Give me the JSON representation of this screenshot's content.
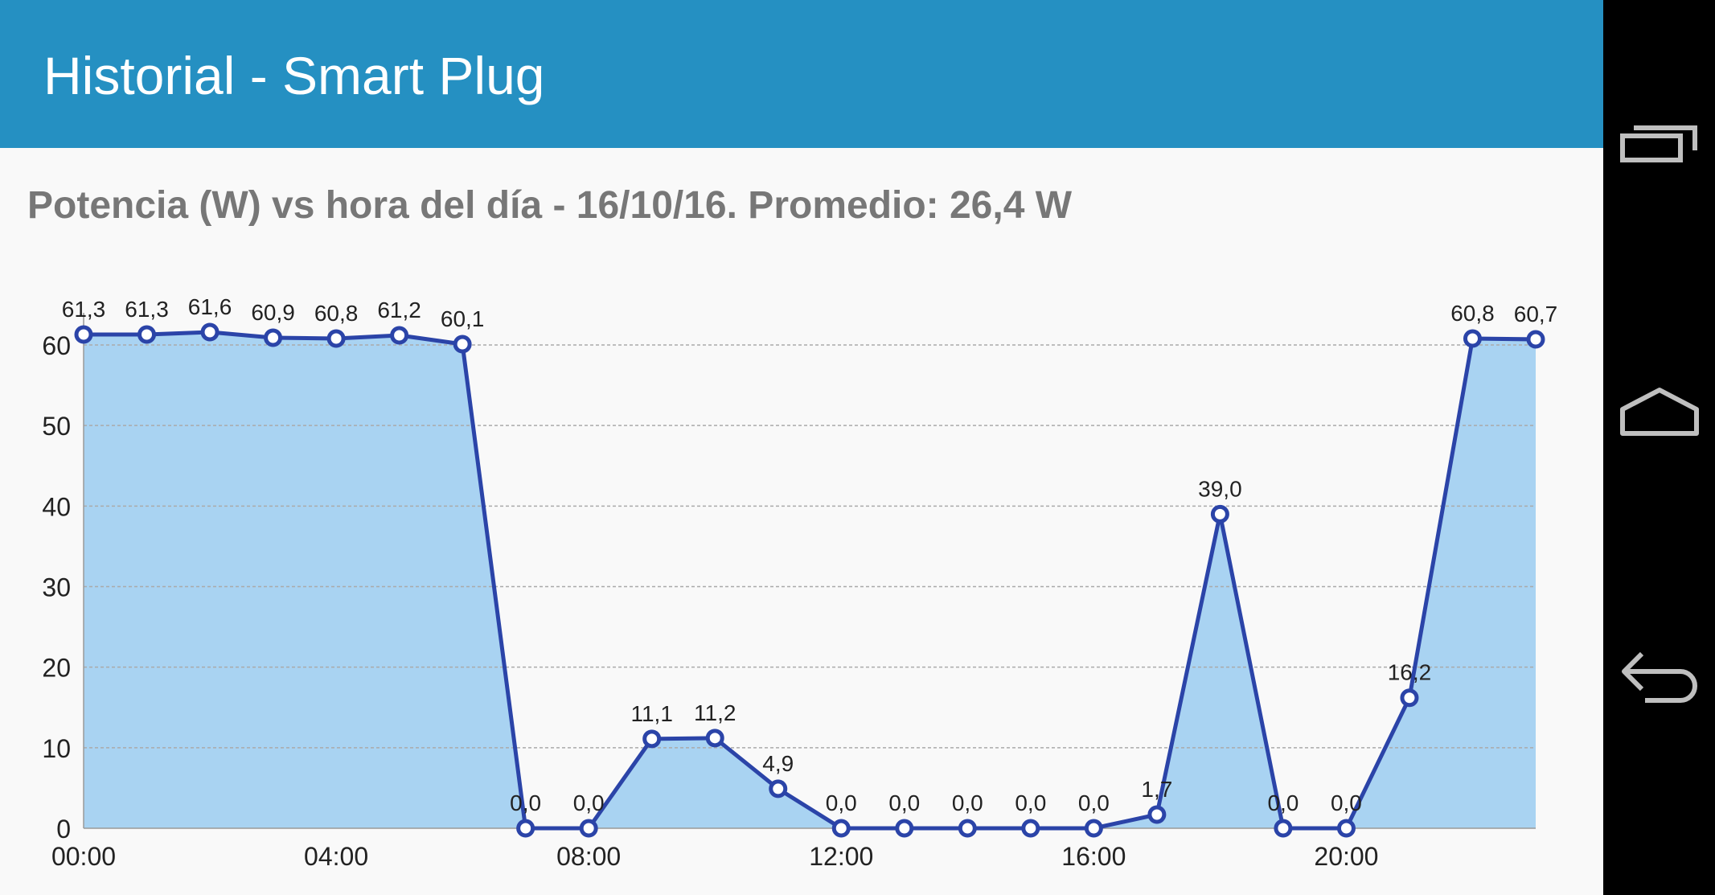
{
  "appbar": {
    "title": "Historial - Smart Plug"
  },
  "chart_title": "Potencia (W) vs hora del día - 16/10/16. Promedio: 26,4 W",
  "chart_data": {
    "type": "area",
    "title": "Potencia (W) vs hora del día - 16/10/16. Promedio: 26,4 W",
    "xlabel": "",
    "ylabel": "",
    "x": [
      0,
      1,
      2,
      3,
      4,
      5,
      6,
      7,
      8,
      9,
      10,
      11,
      12,
      13,
      14,
      15,
      16,
      17,
      18,
      19,
      20,
      21,
      22,
      23
    ],
    "x_tick_values": [
      0,
      4,
      8,
      12,
      16,
      20
    ],
    "x_tick_labels": [
      "00:00",
      "04:00",
      "08:00",
      "12:00",
      "16:00",
      "20:00"
    ],
    "xlim": [
      0,
      23
    ],
    "ylim": [
      0,
      60
    ],
    "y_ticks": [
      0,
      10,
      20,
      30,
      40,
      50,
      60
    ],
    "grid": true,
    "series": [
      {
        "values": [
          61.3,
          61.3,
          61.6,
          60.9,
          60.8,
          61.2,
          60.1,
          0.0,
          0.0,
          11.1,
          11.2,
          4.9,
          0.0,
          0.0,
          0.0,
          0.0,
          0.0,
          1.7,
          39.0,
          0.0,
          0.0,
          16.2,
          60.8,
          60.7
        ],
        "labels": [
          "61,3",
          "61,3",
          "61,6",
          "60,9",
          "60,8",
          "61,2",
          "60,1",
          "0,0",
          "0,0",
          "11,1",
          "11,2",
          "4,9",
          "0,0",
          "0,0",
          "0,0",
          "0,0",
          "0,0",
          "1,7",
          "39,0",
          "0,0",
          "0,0",
          "16,2",
          "60,8",
          "60,7"
        ]
      }
    ],
    "colors": {
      "line": "#2b44a8",
      "fill": "#a9d3f2",
      "grid": "#aaaaaa",
      "text": "#222222"
    }
  },
  "navbar": {
    "recents_icon": "recent-apps-icon",
    "home_icon": "home-icon",
    "back_icon": "back-icon"
  }
}
